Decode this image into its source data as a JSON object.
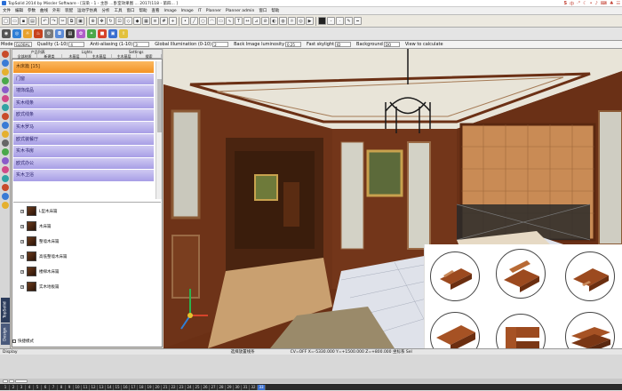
{
  "window": {
    "title": "TopSolid 2014 by Missler Software - [渲染 - 1 - 主卧 ...卧室效果图 ... 2017(118 - 第四... ]"
  },
  "tray": {
    "icons": [
      "sogou-icon",
      "lang-icon",
      "moon-icon",
      "punct-icon",
      "mic-icon",
      "keyboard-icon",
      "shirt-icon",
      "grid-icon"
    ],
    "labels": [
      "中",
      "·°",
      "☾",
      "•",
      "♪",
      "⌨",
      "♣",
      "☷"
    ]
  },
  "menu": {
    "items": [
      "文件",
      "编辑",
      "参数",
      "曲线",
      "外形",
      "装配",
      "运动学仿真",
      "分析",
      "工具",
      "窗口",
      "帮助",
      "查看",
      "Image",
      "Image",
      "IT",
      "Planner",
      "Planner admin",
      "窗口",
      "帮助"
    ]
  },
  "options": {
    "mode_label": "Mode",
    "mode_value": "GLOBAL",
    "quality_label": "Quality (1-10)",
    "quality_value": "4",
    "aa_label": "Anti-aliasing (1-10)",
    "aa_value": "3",
    "gi_label": "Global Illumination (0-10)",
    "gi_value": "2",
    "lum_label": "Back Image luminosity",
    "lum_value": "0.25",
    "sky_label": "Fast skylight",
    "sky_value": "ID",
    "bg_label": "Background",
    "bg_value": "DO",
    "calc_label": "View to calculate"
  },
  "panel": {
    "tabs_top": [
      "产品列表",
      "Lights",
      "Settings"
    ],
    "tabs": [
      "全部材质",
      "新建类",
      "木基层",
      "主木基层",
      "主木基层",
      "搜索"
    ],
    "categories": [
      "木床篇 [15]",
      "门窗",
      "墙饰成品",
      "实木线条",
      "欧式线条",
      "实木罗马",
      "欧式装餐厅",
      "实木书房",
      "欧式办公",
      "实木卫浴"
    ],
    "tree_items": [
      "L型木床篇",
      "木床篇",
      "整墙木床篇",
      "高低整墙木床篇",
      "楼梯木床篇",
      "实木地板篇"
    ],
    "checkbox_label": "快捷模式"
  },
  "left_tabs": {
    "tab1": "TopSolid",
    "tab2": "Design"
  },
  "status": {
    "left": "Display",
    "center": "选择放置线条",
    "coords": "CV=OFF  X=-5330.000  Y=+1500.000  Z=+800.000  坐标系  Sel"
  },
  "frames": [
    "1",
    "2",
    "3",
    "4",
    "5",
    "6",
    "7",
    "8",
    "9",
    "10",
    "11",
    "12",
    "13",
    "14",
    "15",
    "16",
    "17",
    "18",
    "19",
    "20",
    "21",
    "22",
    "23",
    "24",
    "25",
    "26",
    "27",
    "28",
    "29",
    "30",
    "31",
    "32",
    "33"
  ],
  "current_frame": "33",
  "colors": {
    "active_category": "#f39325",
    "category": "#a79ee6",
    "wood": "#6b3015",
    "headboard": "#c98b55"
  }
}
